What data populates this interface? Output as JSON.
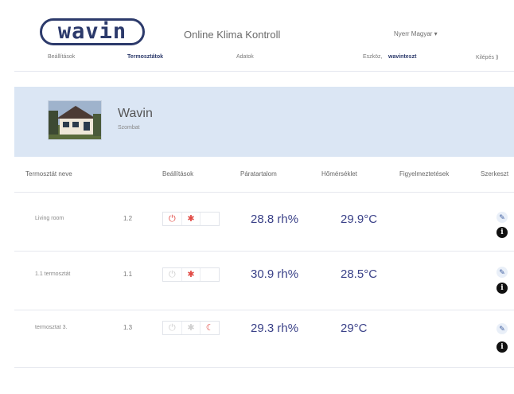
{
  "header": {
    "logo_text": "wavin",
    "app_title": "Online Klima Kontroll",
    "user_menu": "Nyerr Magyar ▾"
  },
  "nav": {
    "settings": "Beállítások",
    "thermostats": "Termosztátok",
    "data": "Adatok",
    "device_label": "Eszköz,",
    "device_name": "wavinteszt",
    "logout": "Kilépés ⟫"
  },
  "site": {
    "name": "Wavin",
    "subtitle": "Szombat"
  },
  "table": {
    "headers": {
      "name": "Termosztát neve",
      "settings": "Beállítások",
      "humidity": "Páratartalom",
      "temperature": "Hőmérséklet",
      "alerts": "Figyelmeztetések",
      "edit": "Szerkeszt"
    },
    "rows": [
      {
        "name": "Living room",
        "zone": "1.2",
        "humidity": "28.8 rh%",
        "temperature": "29.9°C",
        "modes": [
          "power",
          "sun"
        ]
      },
      {
        "name": "1.1 termosztát",
        "zone": "1.1",
        "humidity": "30.9 rh%",
        "temperature": "28.5°C",
        "modes": [
          "sun"
        ]
      },
      {
        "name": "termosztat 3.",
        "zone": "1.3",
        "humidity": "29.3 rh%",
        "temperature": "29°C",
        "modes": [
          "moon"
        ]
      }
    ]
  },
  "icons": {
    "power": "⏻",
    "sun": "✱",
    "moon": "☾",
    "edit": "✎",
    "info": "i"
  },
  "colors": {
    "brand": "#2c3a6b",
    "banner": "#dbe6f4",
    "value": "#3a4188",
    "mode_active": "#e14a44",
    "mode_inactive": "#cfcfcf"
  }
}
